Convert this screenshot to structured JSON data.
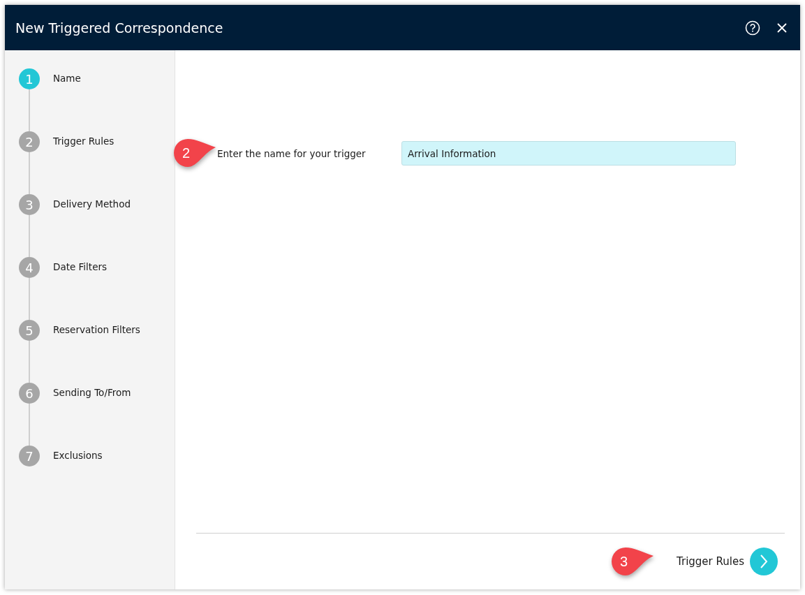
{
  "window": {
    "title": "New Triggered Correspondence"
  },
  "steps": [
    {
      "number": "1",
      "label": "Name",
      "selected": true
    },
    {
      "number": "2",
      "label": "Trigger Rules",
      "selected": false
    },
    {
      "number": "3",
      "label": "Delivery Method",
      "selected": false
    },
    {
      "number": "4",
      "label": "Date Filters",
      "selected": false
    },
    {
      "number": "5",
      "label": "Reservation Filters",
      "selected": false
    },
    {
      "number": "6",
      "label": "Sending To/From",
      "selected": false
    },
    {
      "number": "7",
      "label": "Exclusions",
      "selected": false
    }
  ],
  "form": {
    "label": "Enter the name for your trigger",
    "value": "Arrival Information",
    "callout": "2"
  },
  "footer": {
    "next_label": "Trigger Rules",
    "callout": "3"
  }
}
